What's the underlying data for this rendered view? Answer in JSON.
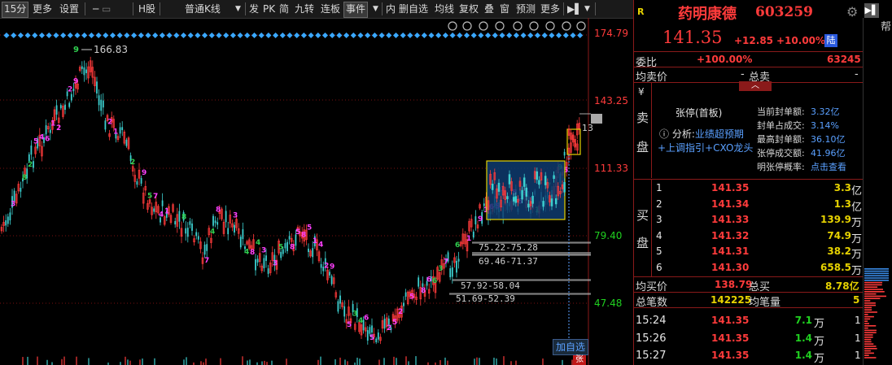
{
  "toolbar": {
    "items": [
      "15分",
      "更多",
      "设置",
      "H股",
      "普通K线",
      "发",
      "PK",
      "简",
      "九转",
      "连板",
      "事件",
      "内",
      "删自选",
      "均线",
      "复权",
      "叠",
      "窗",
      "预测",
      "更多"
    ],
    "period_selected": "15分"
  },
  "chart": {
    "price_labels": [
      "174.79",
      "143.25",
      "111.33",
      "79.40",
      "47.48"
    ],
    "high_label": "166.83",
    "clipped_label": "13",
    "range_labels": [
      "75.22-75.28",
      "69.46-71.37",
      "57.92-58.04",
      "51.69-52.39"
    ],
    "add_watchlist": "加自选",
    "bottom_badge": "张",
    "colors": {
      "up": "#ff3b3b",
      "down": "#3cd0d0",
      "pink_marker": "#ff40ff",
      "green_marker": "#30d050",
      "box_border": "#e6d200",
      "box_fill": "#0e3b6e"
    }
  },
  "stock": {
    "r_badge": "R",
    "name": "药明康德",
    "code": "603259",
    "price": "141.35",
    "change": "+12.85",
    "change_pct": "+10.00%",
    "exchange": "陆",
    "help": "帮",
    "weibi_label": "委比",
    "weibi_value": "+100.00%",
    "weicha_value": "63245",
    "avg_sell_label": "均卖价",
    "avg_sell_value": "-",
    "total_sell_label": "总卖",
    "total_sell_value": "-",
    "sell_label": [
      "卖",
      "盘"
    ],
    "yen": "¥",
    "limit_title": "张停(首板)",
    "analysis_label": "分析:",
    "analysis_value": "业绩超预期",
    "tags": "+上调指引+CXO龙头",
    "limit_info": [
      {
        "k": "当前封单额:",
        "v": "3.32亿"
      },
      {
        "k": "封单占成交:",
        "v": "3.14%"
      },
      {
        "k": "最高封单额:",
        "v": "36.10亿"
      },
      {
        "k": "张停成交额:",
        "v": "41.96亿"
      },
      {
        "k": "明张停概率:",
        "v": "点击查看"
      }
    ],
    "buy_label": [
      "买",
      "盘"
    ],
    "bids": [
      {
        "n": "1",
        "p": "141.35",
        "v": "3.3",
        "u": "亿"
      },
      {
        "n": "2",
        "p": "141.34",
        "v": "1.3",
        "u": "亿"
      },
      {
        "n": "3",
        "p": "141.33",
        "v": "139.9",
        "u": "万"
      },
      {
        "n": "4",
        "p": "141.32",
        "v": "74.9",
        "u": "万"
      },
      {
        "n": "5",
        "p": "141.31",
        "v": "38.2",
        "u": "万"
      },
      {
        "n": "6",
        "p": "141.30",
        "v": "658.5",
        "u": "万"
      }
    ],
    "avg_buy_label": "均买价",
    "avg_buy_value": "138.79",
    "total_buy_label": "总买",
    "total_buy_value": "8.78亿",
    "ticks_label": "总笔数",
    "ticks_value": "142225",
    "avg_vol_label": "均笔量",
    "avg_vol_value": "5",
    "trades": [
      {
        "t": "15:24",
        "p": "141.35",
        "v": "7.1",
        "u": "万",
        "n": "1"
      },
      {
        "t": "15:26",
        "p": "141.35",
        "v": "1.4",
        "u": "万",
        "n": "1"
      },
      {
        "t": "15:27",
        "p": "141.35",
        "v": "1.4",
        "u": "万",
        "n": "1"
      }
    ]
  }
}
